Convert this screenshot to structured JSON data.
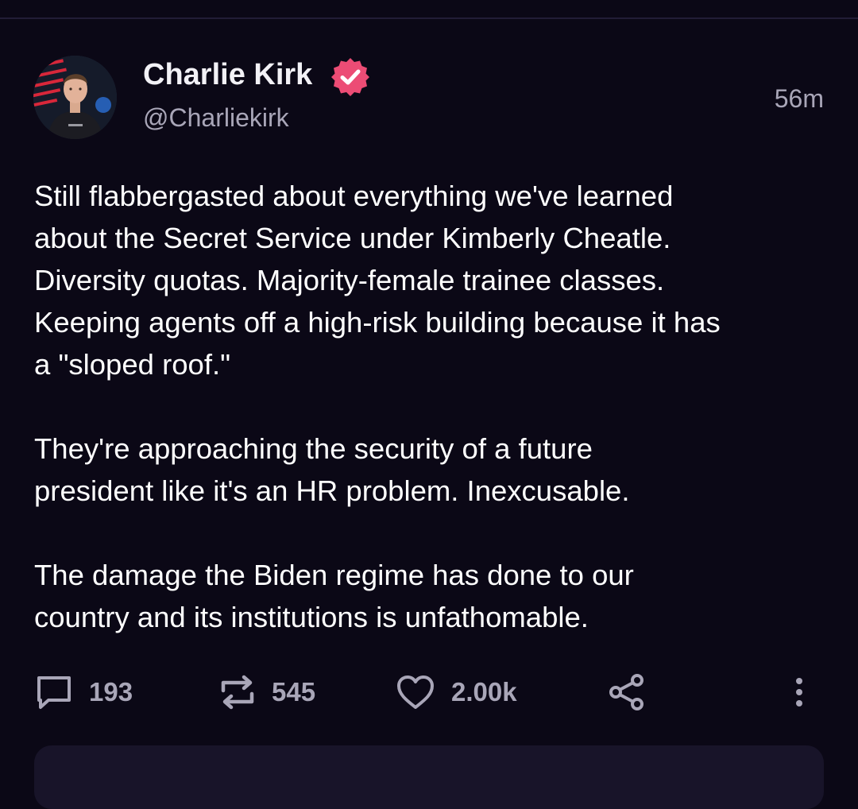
{
  "post": {
    "author": {
      "name": "Charlie Kirk",
      "handle": "@Charliekirk",
      "verified": true,
      "avatar_icon": "user-avatar"
    },
    "timestamp": "56m",
    "paragraphs": [
      "Still flabbergasted about everything we've learned\nabout the Secret Service under Kimberly Cheatle.\nDiversity quotas. Majority-female trainee classes.\nKeeping agents off a high-risk building because it has\na \"sloped roof.\"",
      "They're approaching the security of a future\npresident like it's an HR problem. Inexcusable.",
      "The damage the Biden regime has done to our\ncountry and its institutions is unfathomable."
    ],
    "actions": {
      "replies": "193",
      "reposts": "545",
      "likes": "2.00k"
    }
  },
  "colors": {
    "background": "#0b0816",
    "text": "#ffffff",
    "muted": "#a9a6b8",
    "verified_badge": "#ec4c75",
    "card": "#181429"
  },
  "icons": [
    "reply-icon",
    "repost-icon",
    "heart-icon",
    "share-icon",
    "more-vertical-icon",
    "verified-badge-icon"
  ]
}
